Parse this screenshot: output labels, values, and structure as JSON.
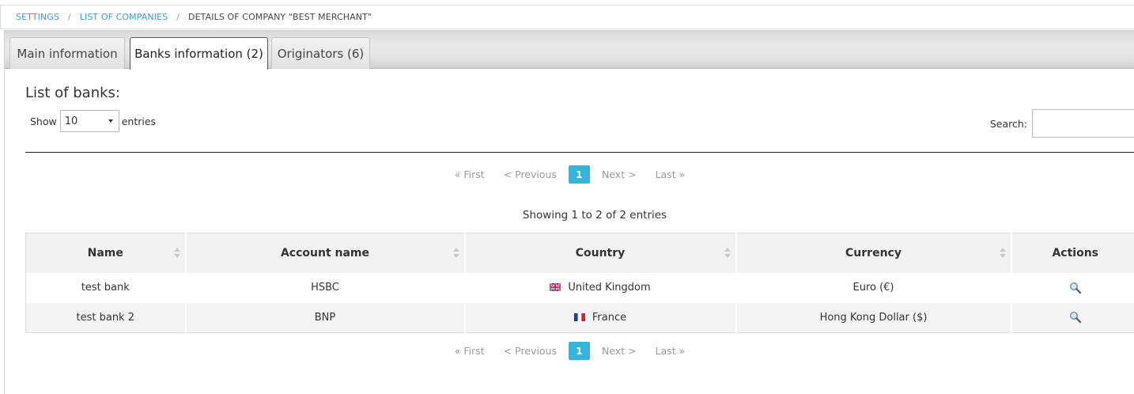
{
  "breadcrumb": {
    "settings": "SETTINGS",
    "companies": "LIST OF COMPANIES",
    "current": "DETAILS OF COMPANY \"BEST MERCHANT\"",
    "separator": "/"
  },
  "tabs": [
    {
      "label": "Main information",
      "active": false
    },
    {
      "label": "Banks information (2)",
      "active": true
    },
    {
      "label": "Originators (6)",
      "active": false
    }
  ],
  "section_title": "List of banks:",
  "length": {
    "show_label": "Show",
    "value": "10",
    "entries_label": "entries"
  },
  "search": {
    "label": "Search:",
    "value": ""
  },
  "pagination": {
    "first": "« First",
    "previous": "< Previous",
    "current": "1",
    "next": "Next >",
    "last": "Last »"
  },
  "info": "Showing 1 to 2 of 2 entries",
  "table": {
    "columns": [
      "Name",
      "Account name",
      "Country",
      "Currency",
      "Actions"
    ],
    "rows": [
      {
        "name": "test bank",
        "account": "HSBC",
        "country": "United Kingdom",
        "flag": "uk-flag-icon",
        "currency": "Euro (€)",
        "action": "magnify-icon"
      },
      {
        "name": "test bank 2",
        "account": "BNP",
        "country": "France",
        "flag": "france-flag-icon",
        "currency": "Hong Kong Dollar ($)",
        "action": "magnify-icon"
      }
    ]
  },
  "colors": {
    "accent": "#33b4dc",
    "link": "#3aa0c8"
  }
}
